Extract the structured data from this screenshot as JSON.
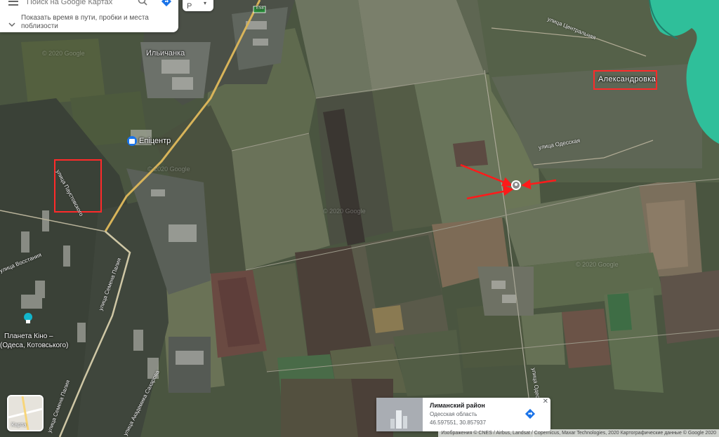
{
  "search": {
    "placeholder": "Поиск на Google Картах",
    "traffic_text": "Показать время в пути, пробки и места поблизости",
    "layers_label": "Р"
  },
  "map_labels": {
    "ilichanka": "Ильичанка",
    "epicentr": "Епіцентр",
    "aleksandrovka": "Александровка",
    "planeta_kino": "Планета Кіно –",
    "planeta_kino2": "(Одеса, Котовського)",
    "highway": "E58",
    "watermark": "© 2020 Google"
  },
  "streets": {
    "tsentralnaya": "улица Центральная",
    "odesskaya": "улица Одесская",
    "pavlova": "улица Паустовского",
    "vosstaniya": "улица Восстания",
    "semena_palia": "улица Семена Палия",
    "semena_palia2": "улица Семена Палия",
    "akademika": "улица Академика Сахарова",
    "odesskaya_vert": "улица Одесская"
  },
  "info_card": {
    "title": "Лиманский район",
    "subtitle": "Одесская область",
    "coords": "46.597551, 30.857937"
  },
  "map_type_button": {
    "label": "Карта"
  },
  "attribution": "Изображения © CNES / Airbus, Landsat / Copernicus, Maxar Technologies, 2020 Картографические данные © Google 2020",
  "colors": {
    "highlight_box": "#ff2a2a",
    "arrow": "#ff1a1a",
    "water": "#2fbf9a",
    "directions": "#1a73e8"
  }
}
